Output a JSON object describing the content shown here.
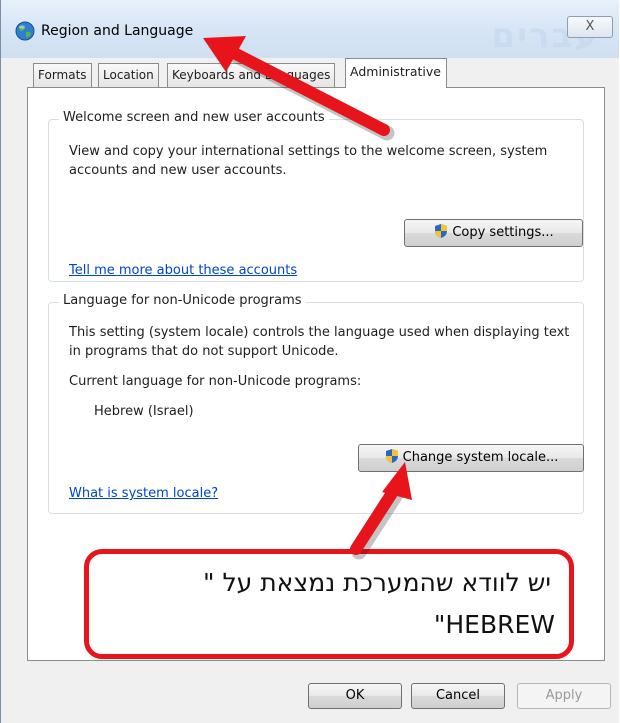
{
  "window": {
    "title": "Region and Language",
    "close_label": "X",
    "watermark_text": "עברים"
  },
  "tabs": [
    {
      "label": "Formats"
    },
    {
      "label": "Location"
    },
    {
      "label": "Keyboards and Languages"
    },
    {
      "label": "Administrative"
    }
  ],
  "welcome_group": {
    "title": "Welcome screen and new user accounts",
    "description": "View and copy your international settings to the welcome screen, system accounts and new user accounts.",
    "button_label": "Copy settings...",
    "link_label": "Tell me more about these accounts"
  },
  "locale_group": {
    "title": "Language for non-Unicode programs",
    "description": "This setting (system locale) controls the language used when displaying text in programs that do not support Unicode.",
    "current_label": "Current language for non-Unicode programs:",
    "current_value": "Hebrew (Israel)",
    "button_label": "Change system locale...",
    "link_label": "What is system locale?"
  },
  "callout": {
    "line1": "יש לוודא שהמערכת נמצאת על \"",
    "line2": "\"HEBREW"
  },
  "buttons": {
    "ok": "OK",
    "cancel": "Cancel",
    "apply": "Apply"
  },
  "colors": {
    "annotation": "#e8141b",
    "link": "#0044cc"
  },
  "icons": {
    "title": "globe-icon",
    "uac": "shield-icon"
  }
}
